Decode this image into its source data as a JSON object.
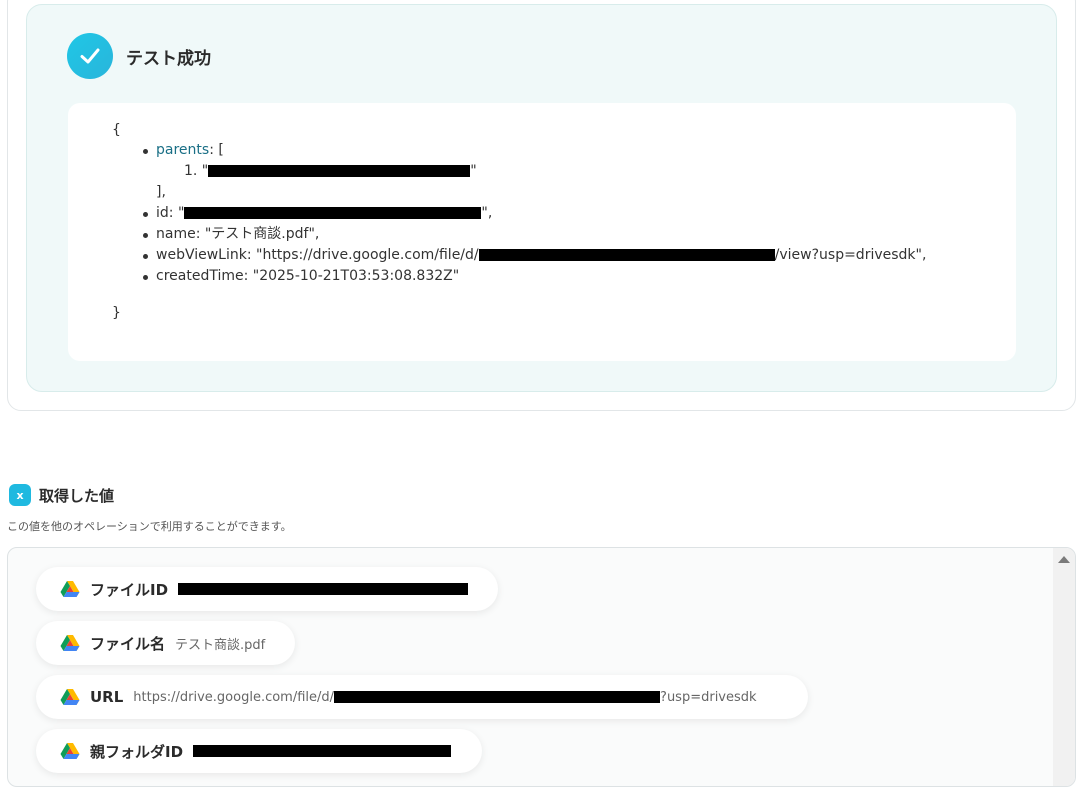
{
  "success": {
    "title": "テスト成功",
    "json": {
      "open_brace": "{",
      "close_brace": "}",
      "parents_key": "parents",
      "parents_open": ": [",
      "parents_item_prefix": "1. \"",
      "quote": "\"",
      "parents_close": "],",
      "id_prefix": "id: \"",
      "id_suffix": "\",",
      "name_line": "name: \"テスト商談.pdf\",",
      "webview_prefix": "webViewLink: \"https://drive.google.com/file/d/",
      "webview_suffix": "/view?usp=drivesdk\",",
      "created_line": "createdTime: \"2025-10-21T03:53:08.832Z\""
    }
  },
  "values": {
    "title": "取得した値",
    "description": "この値を他のオペレーションで利用することができます。",
    "icon": "variable-icon",
    "items": [
      {
        "label": "ファイルID",
        "value_prefix": "",
        "value_suffix": "",
        "icon": "google-drive-icon"
      },
      {
        "label": "ファイル名",
        "value_prefix": "テスト商談.pdf",
        "value_suffix": "",
        "icon": "google-drive-icon"
      },
      {
        "label": "URL",
        "value_prefix": "https://drive.google.com/file/d/",
        "value_suffix": "?usp=drivesdk",
        "icon": "google-drive-icon"
      },
      {
        "label": "親フォルダID",
        "value_prefix": "",
        "value_suffix": "",
        "icon": "google-drive-icon"
      }
    ]
  },
  "colors": {
    "accent": "#1fb9e0",
    "panel_bg": "#f0f9f9",
    "key_link": "#1a6f86"
  }
}
